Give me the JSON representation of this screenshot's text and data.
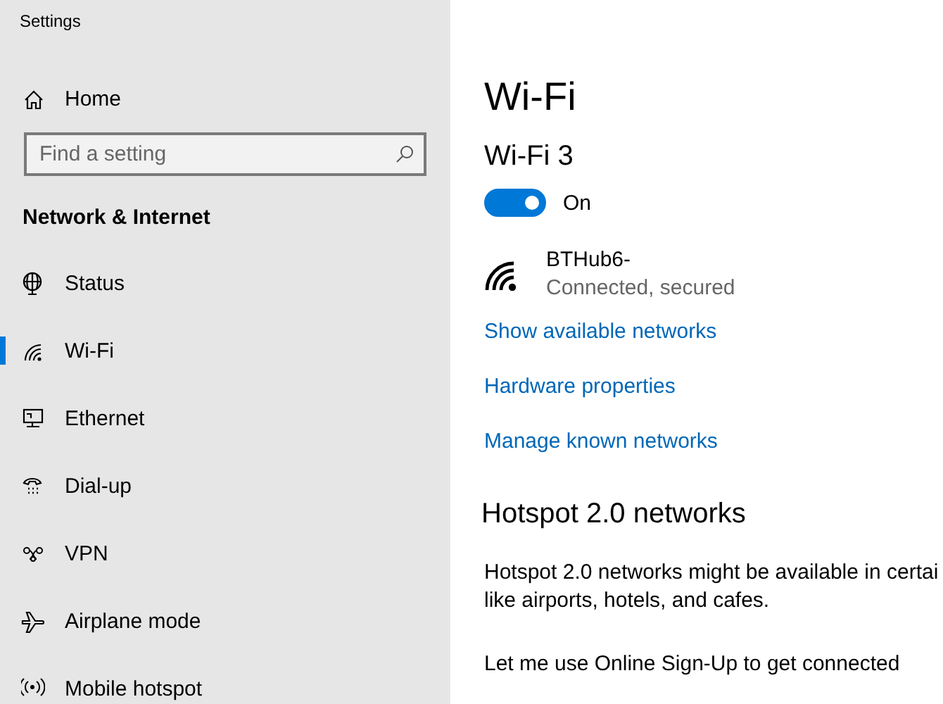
{
  "window": {
    "title": "Settings"
  },
  "sidebar": {
    "home": "Home",
    "search": {
      "placeholder": "Find a setting"
    },
    "section": "Network & Internet",
    "items": [
      {
        "label": "Status",
        "kind": "status",
        "selected": false
      },
      {
        "label": "Wi-Fi",
        "kind": "wifi",
        "selected": true
      },
      {
        "label": "Ethernet",
        "kind": "ethernet",
        "selected": false
      },
      {
        "label": "Dial-up",
        "kind": "dialup",
        "selected": false
      },
      {
        "label": "VPN",
        "kind": "vpn",
        "selected": false
      },
      {
        "label": "Airplane mode",
        "kind": "airplane",
        "selected": false
      },
      {
        "label": "Mobile hotspot",
        "kind": "hotspot",
        "selected": false
      }
    ]
  },
  "main": {
    "title": "Wi-Fi",
    "adapter": "Wi-Fi 3",
    "toggle": {
      "on": true,
      "label": "On"
    },
    "network": {
      "name": "BTHub6-",
      "status": "Connected, secured"
    },
    "links": [
      "Show available networks",
      "Hardware properties",
      "Manage known networks"
    ],
    "hotspot": {
      "heading": "Hotspot 2.0 networks",
      "lines": [
        "Hotspot 2.0 networks might be available in certai",
        "like airports, hotels, and cafes."
      ],
      "signup": "Let me use Online Sign-Up to get connected"
    }
  }
}
